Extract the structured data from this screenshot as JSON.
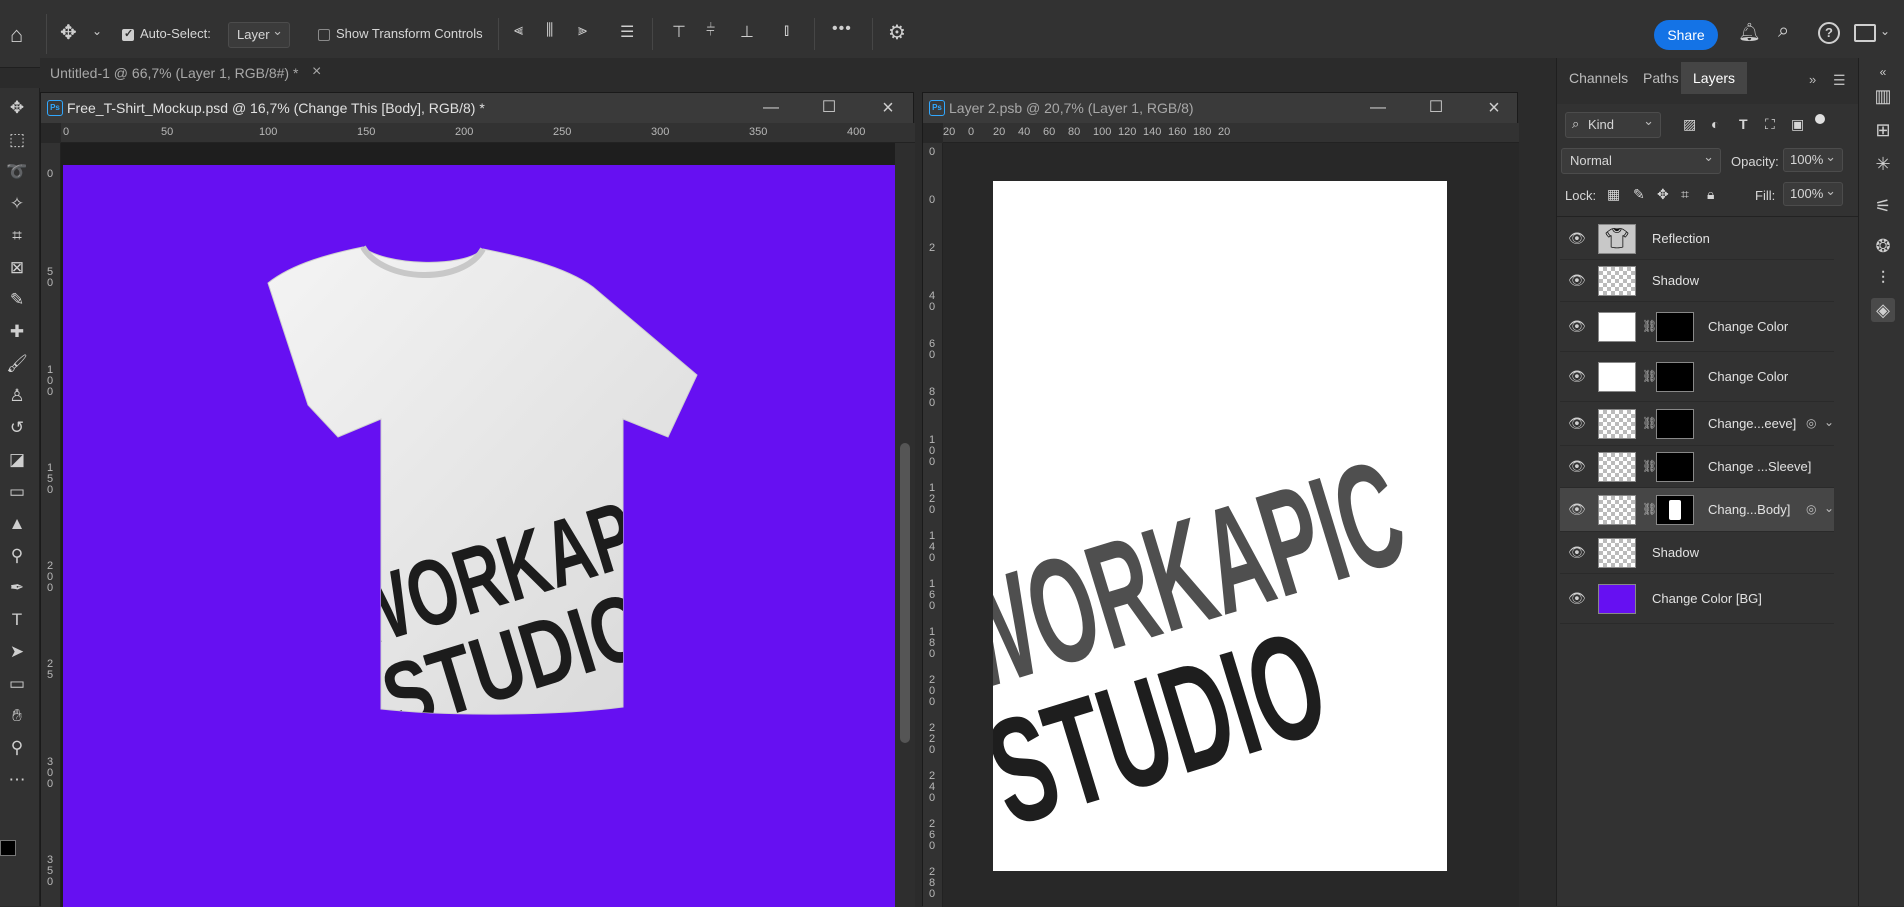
{
  "options_bar": {
    "auto_select_label": "Auto-Select:",
    "auto_select_value": "Layer",
    "show_transform_label": "Show Transform Controls",
    "share_label": "Share",
    "more_label": "•••"
  },
  "doc_tab": {
    "title": "Untitled-1 @ 66,7% (Layer 1, RGB/8#) *",
    "close": "×"
  },
  "window1": {
    "title": "Free_T-Shirt_Mockup.psd @ 16,7% (Change This [Body], RGB/8) *",
    "ps_icon": "Ps",
    "ruler_h": [
      "0",
      "50",
      "100",
      "150",
      "200",
      "250",
      "300",
      "350",
      "400"
    ],
    "ruler_v": [
      "0",
      "5\n0",
      "1\n0\n0",
      "1\n5\n0",
      "2\n0\n0",
      "2\n5",
      "3\n0\n0",
      "3\n5\n0"
    ],
    "canvas_bg": "#6610f2",
    "shirt_text_line1": "WORKAPIC",
    "shirt_text_line2": "STUDIO"
  },
  "window2": {
    "title": "Layer 2.psb @ 20,7% (Layer 1, RGB/8)",
    "ps_icon": "Ps",
    "ruler_h": [
      "20",
      "0",
      "20",
      "40",
      "60",
      "80",
      "100",
      "120",
      "140",
      "160",
      "180",
      "20"
    ],
    "ruler_v": [
      "0",
      "0",
      "2",
      "4\n0",
      "6\n0",
      "8\n0",
      "1\n0\n0",
      "1\n2\n0",
      "1\n4\n0",
      "1\n6\n0",
      "1\n8\n0",
      "2\n0\n0",
      "2\n2\n0",
      "2\n4\n0",
      "2\n6\n0",
      "2\n8\n0"
    ],
    "text_line1": "WORKAPIC",
    "text_line2": "STUDIO"
  },
  "layers_panel": {
    "tabs": [
      "Channels",
      "Paths",
      "Layers"
    ],
    "active_tab": "Layers",
    "filter_label": "Kind",
    "blend_mode": "Normal",
    "opacity_label": "Opacity:",
    "opacity_value": "100%",
    "lock_label": "Lock:",
    "fill_label": "Fill:",
    "fill_value": "100%",
    "layers": [
      {
        "name": "Reflection",
        "has_mask": false,
        "selected": false,
        "smart": false
      },
      {
        "name": "Shadow",
        "has_mask": false,
        "selected": false,
        "smart": false
      },
      {
        "name": "Change Color",
        "has_mask": true,
        "selected": false,
        "smart": false
      },
      {
        "name": "Change Color",
        "has_mask": true,
        "selected": false,
        "smart": false
      },
      {
        "name": "Change...eeve]",
        "has_mask": true,
        "selected": false,
        "smart": true
      },
      {
        "name": "Change ...Sleeve]",
        "has_mask": true,
        "selected": false,
        "smart": true
      },
      {
        "name": "Chang...Body]",
        "has_mask": true,
        "selected": true,
        "smart": true
      },
      {
        "name": "Shadow",
        "has_mask": false,
        "selected": false,
        "smart": false
      },
      {
        "name": "Change Color [BG]",
        "has_mask": false,
        "selected": false,
        "smart": false
      }
    ]
  },
  "colors": {
    "accent": "#1473e6",
    "canvas_purple": "#6610f2",
    "app_bg": "#2b2b2b",
    "panel_bg": "#323232"
  }
}
